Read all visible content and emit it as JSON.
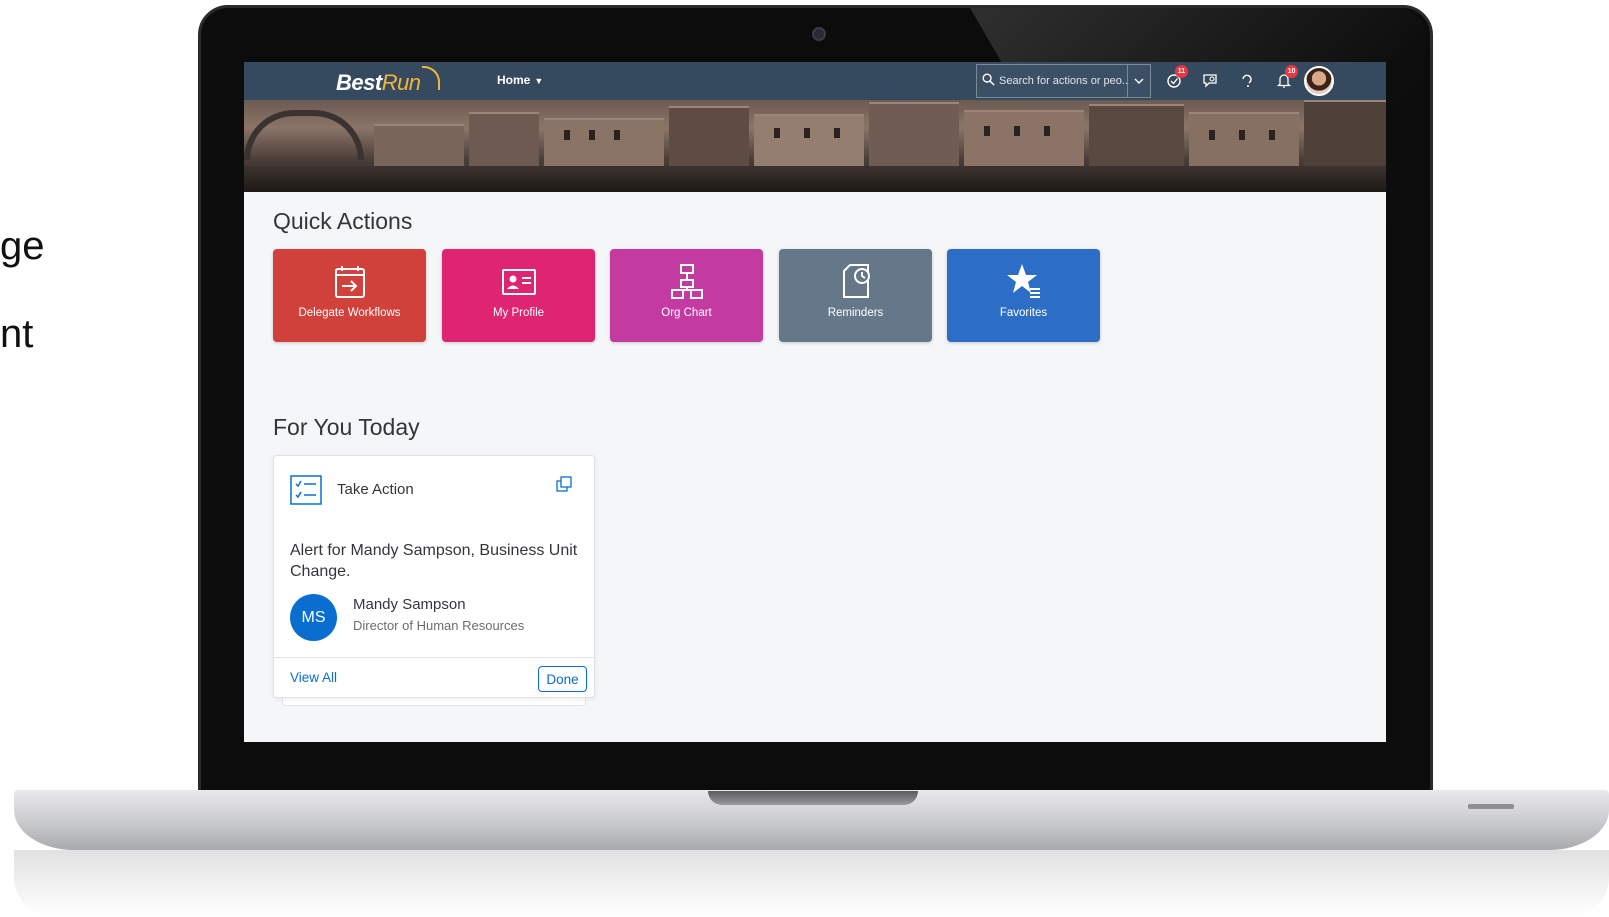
{
  "side_text": {
    "line1": "ge",
    "line2": "nt"
  },
  "shellbar": {
    "logo_main": "Best",
    "logo_accent": "Run",
    "home_label": "Home",
    "search_placeholder": "Search for actions or peo...",
    "notification_badges": {
      "tasks": "11",
      "alerts": "10"
    }
  },
  "quick_actions": {
    "title": "Quick Actions",
    "tiles": [
      {
        "label": "Delegate Workflows",
        "icon": "delegate-workflows-icon",
        "color": "#d0413b"
      },
      {
        "label": "My Profile",
        "icon": "profile-card-icon",
        "color": "#df2472"
      },
      {
        "label": "Org Chart",
        "icon": "org-chart-icon",
        "color": "#c33aa0"
      },
      {
        "label": "Reminders",
        "icon": "reminders-icon",
        "color": "#65788a"
      },
      {
        "label": "Favorites",
        "icon": "favorites-star-icon",
        "color": "#2c6ec5"
      }
    ]
  },
  "for_you_today": {
    "title": "For You Today",
    "card": {
      "header": "Take Action",
      "message": "Alert for Mandy Sampson, Business Unit Change.",
      "avatar_initials": "MS",
      "person_name": "Mandy Sampson",
      "person_role": "Director of Human Resources",
      "view_all": "View All",
      "done": "Done"
    }
  },
  "colors": {
    "shell": "#354a5f",
    "accent": "#0a6ed1",
    "brand": "#f0b63c"
  }
}
